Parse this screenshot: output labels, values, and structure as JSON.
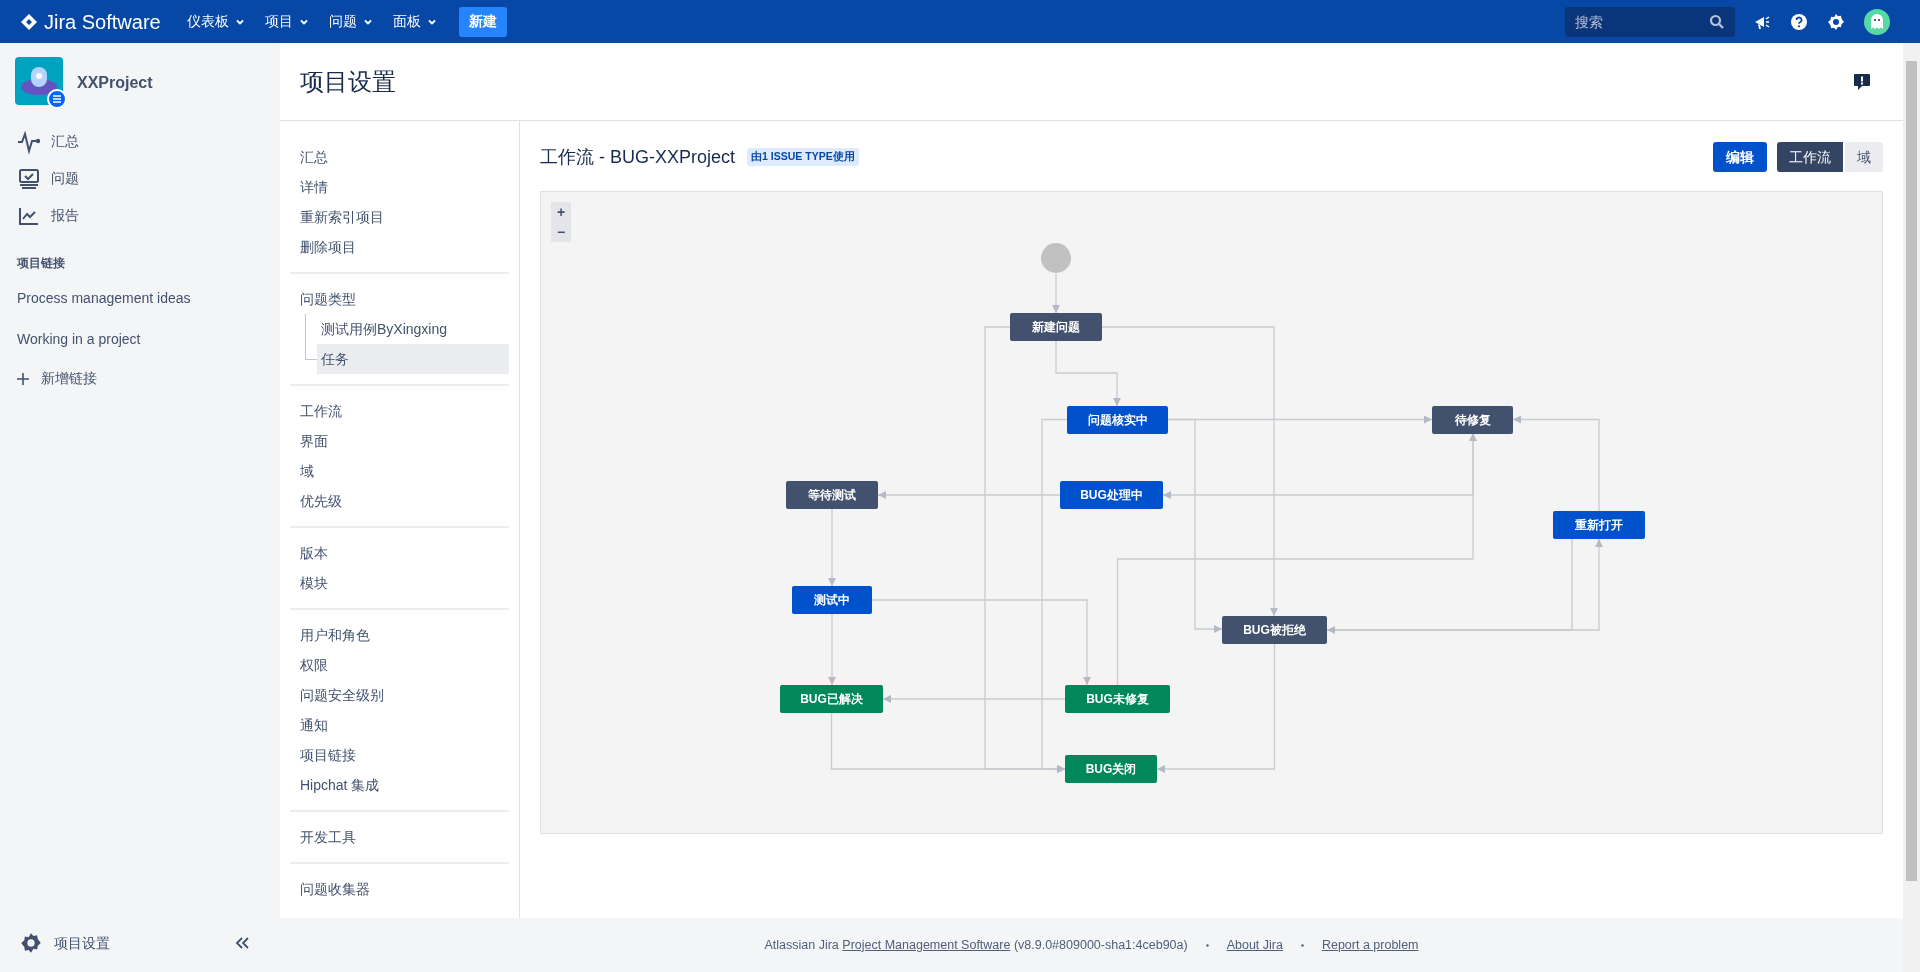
{
  "topbar": {
    "logo": "Jira Software",
    "menus": [
      "仪表板",
      "项目",
      "问题",
      "面板"
    ],
    "create_button": "新建",
    "search": {
      "placeholder": "搜索"
    }
  },
  "sidebar": {
    "project_name": "XXProject",
    "nav": [
      {
        "label": "汇总"
      },
      {
        "label": "问题"
      },
      {
        "label": "报告"
      }
    ],
    "links_heading": "项目链接",
    "links": [
      "Process management ideas",
      "Working in a project"
    ],
    "add_link": "新增链接",
    "settings": "项目设置"
  },
  "page_title": "项目设置",
  "settings_nav": [
    [
      {
        "label": "汇总",
        "selected": false
      },
      {
        "label": "详情",
        "selected": false
      },
      {
        "label": "重新索引项目",
        "selected": false
      },
      {
        "label": "删除项目",
        "selected": false
      }
    ],
    [
      {
        "label": "问题类型",
        "selected": false,
        "children": [
          {
            "label": "测试用例ByXingxing",
            "selected": false
          },
          {
            "label": "任务",
            "selected": true
          }
        ]
      }
    ],
    [
      {
        "label": "工作流",
        "selected": false
      },
      {
        "label": "界面",
        "selected": false
      },
      {
        "label": "域",
        "selected": false
      },
      {
        "label": "优先级",
        "selected": false
      }
    ],
    [
      {
        "label": "版本",
        "selected": false
      },
      {
        "label": "模块",
        "selected": false
      }
    ],
    [
      {
        "label": "用户和角色",
        "selected": false
      },
      {
        "label": "权限",
        "selected": false
      },
      {
        "label": "问题安全级别",
        "selected": false
      },
      {
        "label": "通知",
        "selected": false
      },
      {
        "label": "项目链接",
        "selected": false
      },
      {
        "label": "Hipchat 集成",
        "selected": false
      }
    ],
    [
      {
        "label": "开发工具",
        "selected": false
      }
    ],
    [
      {
        "label": "问题收集器",
        "selected": false
      }
    ]
  ],
  "workflow": {
    "title": "工作流 - BUG-XXProject",
    "badge": "由1 ISSUE TYPE使用",
    "edit_button": "编辑",
    "view_tabs": [
      {
        "label": "工作流",
        "selected": true
      },
      {
        "label": "域",
        "selected": false
      }
    ],
    "zoom_controls": [
      "+",
      "−"
    ],
    "statuses": [
      {
        "label": "新建问题",
        "color": "#42526e"
      },
      {
        "label": "问题核实中",
        "color": "#0052cc"
      },
      {
        "label": "待修复",
        "color": "#42526e"
      },
      {
        "label": "等待测试",
        "color": "#42526e"
      },
      {
        "label": "BUG处理中",
        "color": "#0052cc"
      },
      {
        "label": "重新打开",
        "color": "#0052cc"
      },
      {
        "label": "测试中",
        "color": "#0052cc"
      },
      {
        "label": "BUG被拒绝",
        "color": "#42526e"
      },
      {
        "label": "BUG已解决",
        "color": "#00875a"
      },
      {
        "label": "BUG未修复",
        "color": "#00875a"
      },
      {
        "label": "BUG关闭",
        "color": "#00875a"
      }
    ]
  },
  "footer": {
    "prefix": "Atlassian Jira",
    "link": "Project Management Software",
    "version": "(v8.9.0#809000-sha1:4ceb90a)",
    "links": [
      "About Jira",
      "Report a problem"
    ]
  }
}
